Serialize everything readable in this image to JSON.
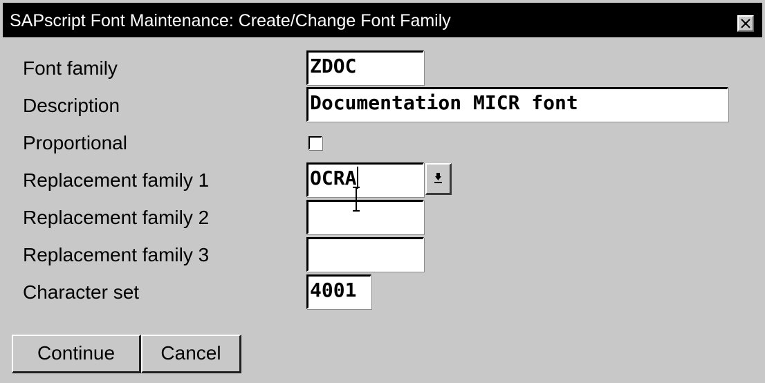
{
  "window": {
    "title": "SAPscript Font Maintenance: Create/Change Font Family",
    "close_icon": "close-x-icon"
  },
  "form": {
    "font_family": {
      "label": "Font family",
      "value": "ZDOC"
    },
    "description": {
      "label": "Description",
      "value": "Documentation MICR font"
    },
    "proportional": {
      "label": "Proportional",
      "checked": false
    },
    "replacement_family_1": {
      "label": "Replacement family 1",
      "value": "OCRA",
      "dropdown_icon": "dropdown-arrow-icon"
    },
    "replacement_family_2": {
      "label": "Replacement family 2",
      "value": ""
    },
    "replacement_family_3": {
      "label": "Replacement family 3",
      "value": ""
    },
    "character_set": {
      "label": "Character set",
      "value": "4001"
    }
  },
  "buttons": {
    "continue_label": "Continue",
    "cancel_label": "Cancel"
  },
  "cursor": {
    "type": "ibeam-cursor-icon"
  }
}
